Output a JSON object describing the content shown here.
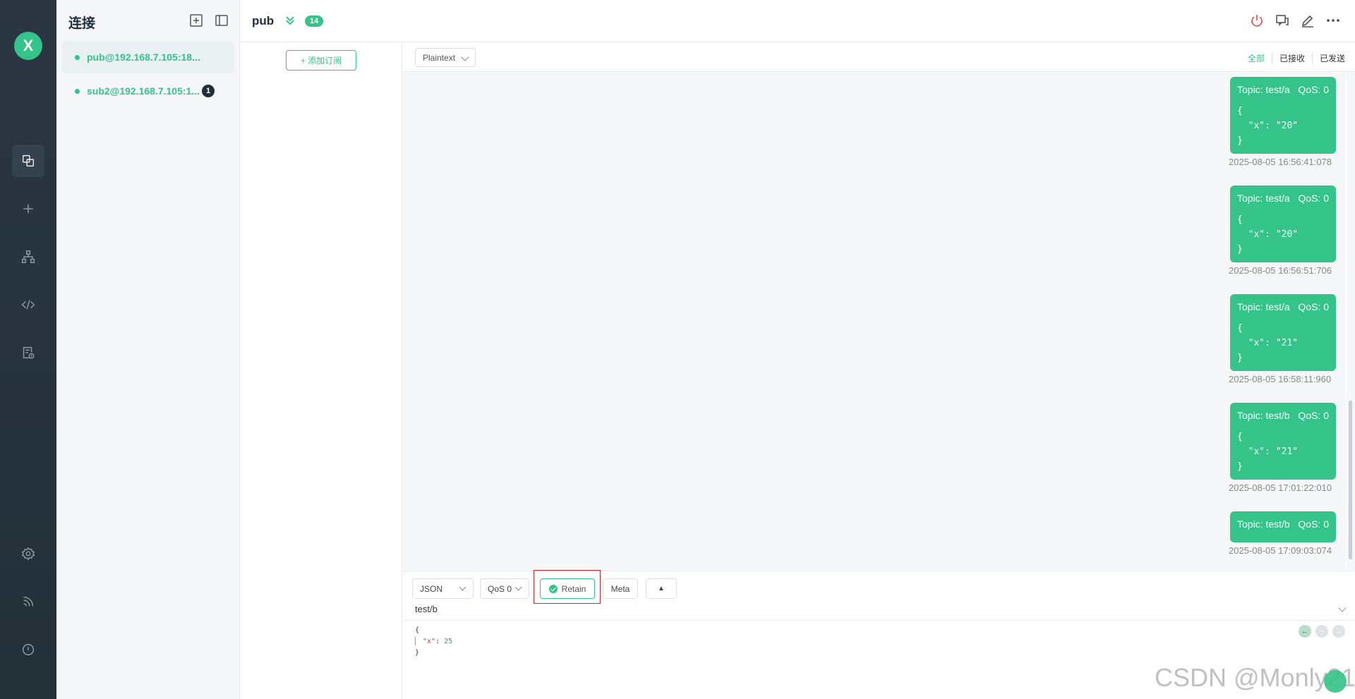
{
  "sidebar": {
    "logo": "X",
    "icons": [
      "connections-icon",
      "plus-icon",
      "topology-icon",
      "code-icon",
      "log-icon",
      "settings-icon",
      "rss-icon",
      "info-icon"
    ]
  },
  "connections": {
    "title": "连接",
    "items": [
      {
        "name": "pub@192.168.7.105:18...",
        "active": true,
        "badge": ""
      },
      {
        "name": "sub2@192.168.7.105:1...",
        "active": false,
        "badge": "1"
      }
    ]
  },
  "topbar": {
    "connection_name": "pub",
    "message_count": "14"
  },
  "subscriptions": {
    "add_label": "+ 添加订阅"
  },
  "messages_toolbar": {
    "format": "Plaintext",
    "filters": [
      "全部",
      "已接收",
      "已发送"
    ]
  },
  "messages": [
    {
      "topic": "Topic: test/a",
      "qos": "QoS: 0",
      "payload": "{\n  \"x\": \"20\"\n}",
      "time": "2025-08-05 16:56:41:078"
    },
    {
      "topic": "Topic: test/a",
      "qos": "QoS: 0",
      "payload": "{\n  \"x\": \"20\"\n}",
      "time": "2025-08-05 16:56:51:706"
    },
    {
      "topic": "Topic: test/a",
      "qos": "QoS: 0",
      "payload": "{\n  \"x\": \"21\"\n}",
      "time": "2025-08-05 16:58:11:960"
    },
    {
      "topic": "Topic: test/b",
      "qos": "QoS: 0",
      "payload": "{\n  \"x\": \"21\"\n}",
      "time": "2025-08-05 17:01:22:010"
    },
    {
      "topic": "Topic: test/b",
      "qos": "QoS: 0",
      "payload": "",
      "time": "2025-08-05 17:09:03:074"
    }
  ],
  "composer": {
    "payload_format": "JSON",
    "qos": "QoS 0",
    "retain_label": "Retain",
    "meta_label": "Meta",
    "expand_label": "▲",
    "topic": "test/b",
    "payload_open": "{",
    "payload_key": "\"x\"",
    "payload_sep": ": ",
    "payload_value": "25",
    "payload_close": "}"
  },
  "watermark": "CSDN @Monly21",
  "colors": {
    "accent": "#34c388",
    "rail_bg": "#2b3642",
    "highlight": "#d9262c"
  }
}
